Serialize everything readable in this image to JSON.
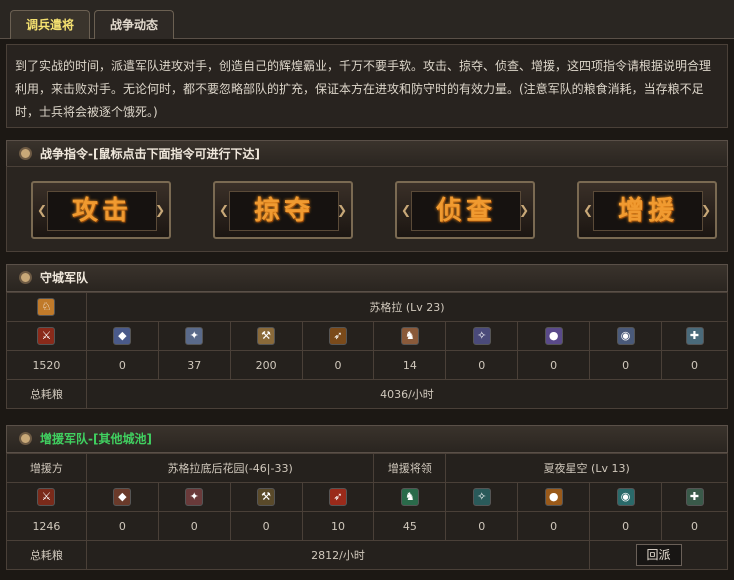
{
  "tabs": [
    {
      "label": "调兵遣将"
    },
    {
      "label": "战争动态"
    }
  ],
  "intro": "到了实战的时间，派遣军队进攻对手，创造自己的辉煌霸业，千万不要手软。攻击、掠夺、侦查、增援，这四项指令请根据说明合理利用，来击败对手。无论何时，都不要忽略部队的扩充，保证本方在进攻和防守时的有效力量。(注意军队的粮食消耗，当存粮不足时，士兵将会被逐个饿死。)",
  "command_panel": {
    "title": "战争指令-[鼠标点击下面指令可进行下达]",
    "commands": [
      {
        "label": "攻击"
      },
      {
        "label": "掠夺"
      },
      {
        "label": "侦查"
      },
      {
        "label": "增援"
      }
    ]
  },
  "defense": {
    "title": "守城军队",
    "hero": "苏格拉 (Lv 23)",
    "units": [
      {
        "icon": "spear-soldier-icon",
        "color": "#8a2a1a",
        "glyph": "⚔",
        "count": "1520"
      },
      {
        "icon": "shield-soldier-icon",
        "color": "#4a5a8a",
        "glyph": "◆",
        "count": "0"
      },
      {
        "icon": "sword-soldier-icon",
        "color": "#5a6a8a",
        "glyph": "✦",
        "count": "37"
      },
      {
        "icon": "axe-soldier-icon",
        "color": "#8a6a3a",
        "glyph": "⚒",
        "count": "200"
      },
      {
        "icon": "archer-icon",
        "color": "#7a4a1a",
        "glyph": "➶",
        "count": "0"
      },
      {
        "icon": "knight-icon",
        "color": "#8a5a3a",
        "glyph": "♞",
        "count": "14"
      },
      {
        "icon": "mage-icon",
        "color": "#4a4a7a",
        "glyph": "✧",
        "count": "0"
      },
      {
        "icon": "orb-unit-icon",
        "color": "#5a4a8a",
        "glyph": "●",
        "count": "0"
      },
      {
        "icon": "scout-unit-icon",
        "color": "#4a5a7a",
        "glyph": "◉",
        "count": "0"
      },
      {
        "icon": "siege-unit-icon",
        "color": "#4a6a7a",
        "glyph": "✚",
        "count": "0"
      }
    ],
    "food_label": "总耗粮",
    "food_value": "4036/小时"
  },
  "reinforce": {
    "title": "增援军队-[其他城池]",
    "from_label": "增援方",
    "from_value": "苏格拉底后花园(-46|-33)",
    "leader_label": "增援将领",
    "leader_value": "夏夜星空 (Lv 13)",
    "units": [
      {
        "icon": "spear-soldier-icon",
        "color": "#7a2a1a",
        "glyph": "⚔",
        "count": "1246"
      },
      {
        "icon": "shield-soldier-icon",
        "color": "#6a3a2a",
        "glyph": "◆",
        "count": "0"
      },
      {
        "icon": "sword-soldier-icon",
        "color": "#6a3a3a",
        "glyph": "✦",
        "count": "0"
      },
      {
        "icon": "axe-soldier-icon",
        "color": "#5a4a2a",
        "glyph": "⚒",
        "count": "0"
      },
      {
        "icon": "archer-icon",
        "color": "#9a2a1a",
        "glyph": "➶",
        "count": "10"
      },
      {
        "icon": "knight-icon",
        "color": "#2a6a4a",
        "glyph": "♞",
        "count": "45"
      },
      {
        "icon": "mage-icon",
        "color": "#2a5a5a",
        "glyph": "✧",
        "count": "0"
      },
      {
        "icon": "orb-unit-icon",
        "color": "#9a5a1a",
        "glyph": "●",
        "count": "0"
      },
      {
        "icon": "scout-unit-icon",
        "color": "#2a6a6a",
        "glyph": "◉",
        "count": "0"
      },
      {
        "icon": "siege-unit-icon",
        "color": "#3a5a4a",
        "glyph": "✚",
        "count": "0"
      }
    ],
    "food_label": "总耗粮",
    "food_value": "2812/小时",
    "recall_label": "回派"
  }
}
